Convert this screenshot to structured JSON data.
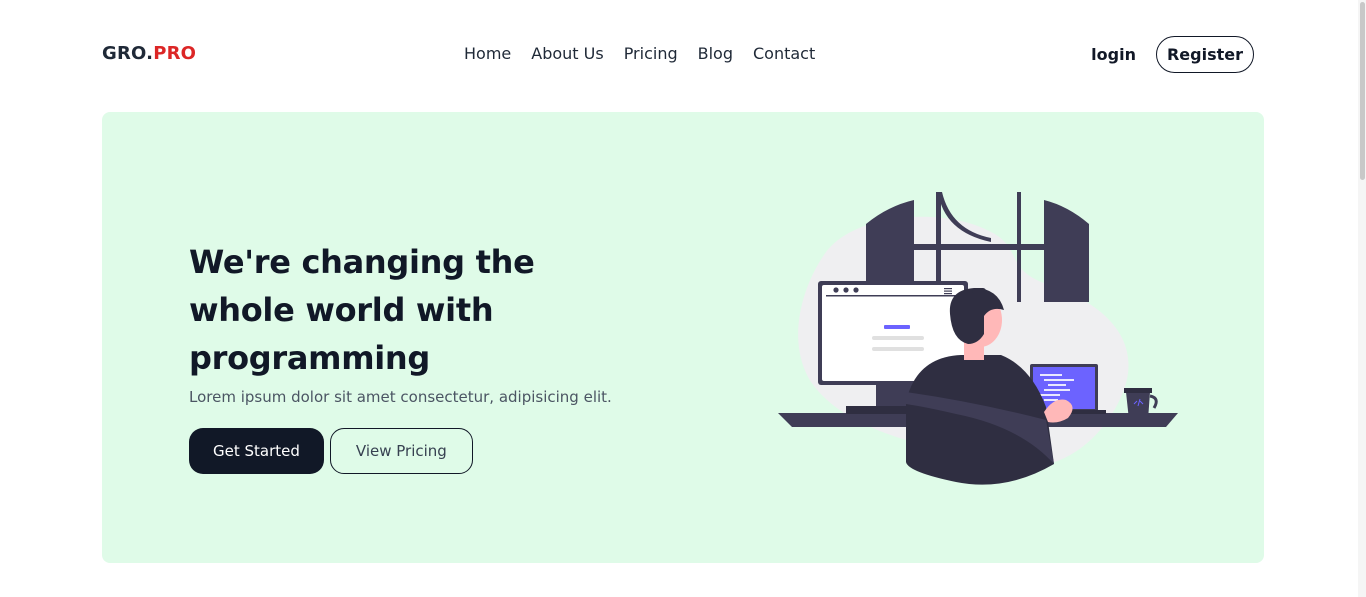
{
  "brand": {
    "part1": "GRO.",
    "part2": "PRO"
  },
  "nav": {
    "items": [
      "Home",
      "About Us",
      "Pricing",
      "Blog",
      "Contact"
    ]
  },
  "auth": {
    "login": "login",
    "register": "Register"
  },
  "hero": {
    "headline_line1": "We're changing the",
    "headline_line2": "whole world with programming",
    "subtitle": "Lorem ipsum dolor sit amet consectetur, adipisicing elit.",
    "primary_cta": "Get Started",
    "secondary_cta": "View Pricing"
  },
  "colors": {
    "hero_bg": "#dffbe8",
    "primary": "#111827",
    "brand_accent": "#dc2626",
    "illustration_dark": "#3f3d56",
    "illustration_purple": "#6c63ff"
  }
}
